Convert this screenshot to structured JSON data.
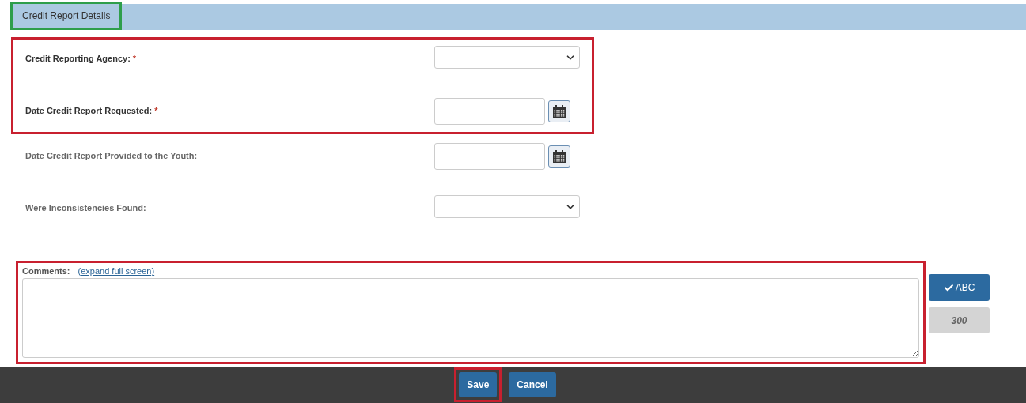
{
  "section": {
    "title": "Credit Report Details",
    "highlighted": true
  },
  "field_groups": [
    {
      "highlighted": true,
      "fields": [
        {
          "kind": "select",
          "label": "Credit Reporting Agency:",
          "required": true,
          "marker": "*"
        },
        {
          "kind": "date",
          "label": "Date Credit Report Requested:",
          "required": true,
          "marker": "*"
        }
      ]
    },
    {
      "highlighted": false,
      "fields": [
        {
          "kind": "date",
          "label": "Date Credit Report Provided to the Youth:",
          "required": false
        },
        {
          "kind": "select",
          "label": "Were Inconsistencies Found:",
          "required": false
        }
      ]
    }
  ],
  "comments": {
    "highlighted": true,
    "label": "Comments:",
    "link": "(expand full screen)",
    "spell_check": "ABC",
    "counter": "300"
  },
  "footer": {
    "buttons": [
      {
        "label": "Save",
        "highlighted": true
      },
      {
        "label": "Cancel",
        "highlighted": false
      }
    ]
  }
}
